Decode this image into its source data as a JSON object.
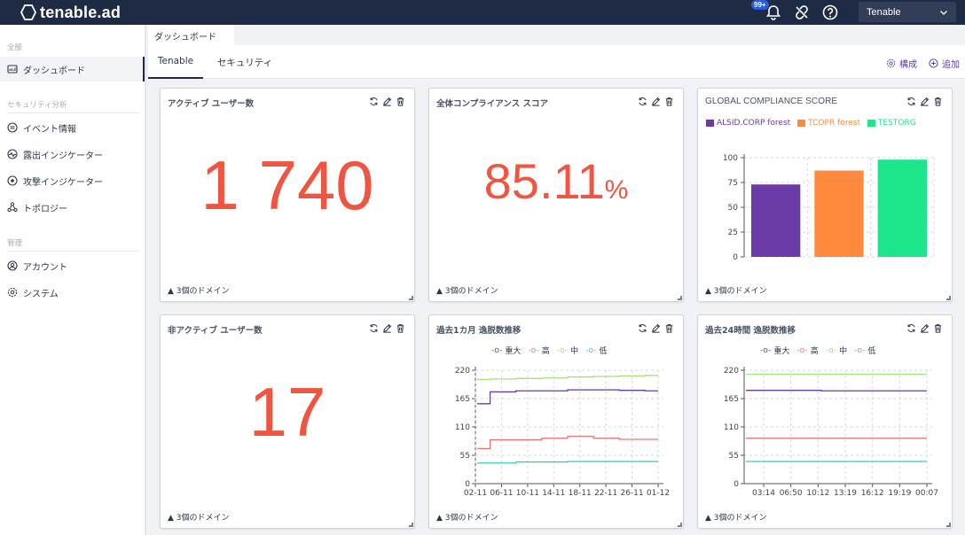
{
  "app": {
    "logo_text": "tenable.ad",
    "notification_count": "99+",
    "tenant": "Tenable"
  },
  "sidebar": {
    "section_general": "全般",
    "dashboard": "ダッシュボード",
    "section_security": "セキュリティ分析",
    "events": "イベント情報",
    "ioe": "露出インジケーター",
    "ioa": "攻撃インジケーター",
    "topology": "トポロジー",
    "section_admin": "管理",
    "accounts": "アカウント",
    "system": "システム"
  },
  "page": {
    "tab_label": "ダッシュボード",
    "tabs": [
      "Tenable",
      "セキュリティ"
    ],
    "configure": "構成",
    "add": "追加"
  },
  "widgets": {
    "active_users": {
      "title": "アクティブ ユーザー数",
      "value": "1 740",
      "footer": "3個のドメイン"
    },
    "compliance": {
      "title": "全体コンプライアンス スコア",
      "value": "85.11",
      "unit": "%",
      "footer": "3個のドメイン"
    },
    "global": {
      "title": "GLOBAL COMPLIANCE SCORE",
      "footer": "3個のドメイン"
    },
    "inactive_users": {
      "title": "非アクティブ ユーザー数",
      "value": "17",
      "footer": "3個のドメイン"
    },
    "monthly": {
      "title": "過去1カ月 逸脱数推移",
      "footer": "3個のドメイン"
    },
    "daily": {
      "title": "過去24時間 逸脱数推移",
      "footer": "3個のドメイン"
    }
  },
  "colors": {
    "accent": "#ef5540",
    "critical": "#6a3aa7",
    "high": "#e87474",
    "medium": "#a5e07a",
    "low": "#3cc7c7",
    "bar_alsid": "#6a3aa7",
    "bar_tcopr": "#ff8a3d",
    "bar_testorg": "#1de58a"
  },
  "chart_data": [
    {
      "type": "bar",
      "categories": [
        "ALSID.CORP forest",
        "TCOPR forest",
        "TESTORG"
      ],
      "values": [
        73,
        87,
        98
      ],
      "ylim": [
        0,
        100
      ],
      "yticks": [
        "0",
        "25",
        "50",
        "75",
        "100"
      ],
      "legend": [
        "ALSID.CORP forest",
        "TCOPR forest",
        "TESTORG"
      ],
      "grid": true
    },
    {
      "type": "line",
      "x": [
        "02-11",
        "06-11",
        "10-11",
        "14-11",
        "18-11",
        "22-11",
        "26-11",
        "01-12"
      ],
      "ylim": [
        0,
        220
      ],
      "yticks": [
        "0",
        "55",
        "110",
        "165",
        "220"
      ],
      "grid": true,
      "series": [
        {
          "name": "重大",
          "values": [
            155,
            178,
            180,
            180,
            182,
            182,
            181,
            180
          ]
        },
        {
          "name": "高",
          "values": [
            68,
            85,
            85,
            88,
            92,
            88,
            86,
            86
          ]
        },
        {
          "name": "中",
          "values": [
            202,
            203,
            204,
            205,
            207,
            208,
            209,
            210
          ]
        },
        {
          "name": "低",
          "values": [
            40,
            40,
            42,
            42,
            43,
            43,
            43,
            43
          ]
        }
      ]
    },
    {
      "type": "line",
      "x": [
        "03:14",
        "06:50",
        "10:12",
        "13:19",
        "16:12",
        "19:19",
        "00:07"
      ],
      "ylim": [
        0,
        220
      ],
      "yticks": [
        "0",
        "55",
        "110",
        "165",
        "220"
      ],
      "grid": true,
      "series": [
        {
          "name": "重大",
          "values": [
            181,
            181,
            181,
            180,
            180,
            180,
            180
          ]
        },
        {
          "name": "高",
          "values": [
            88,
            88,
            88,
            88,
            88,
            88,
            88
          ]
        },
        {
          "name": "中",
          "values": [
            212,
            212,
            212,
            212,
            212,
            212,
            212
          ]
        },
        {
          "name": "低",
          "values": [
            43,
            43,
            43,
            43,
            43,
            43,
            43
          ]
        }
      ]
    }
  ]
}
